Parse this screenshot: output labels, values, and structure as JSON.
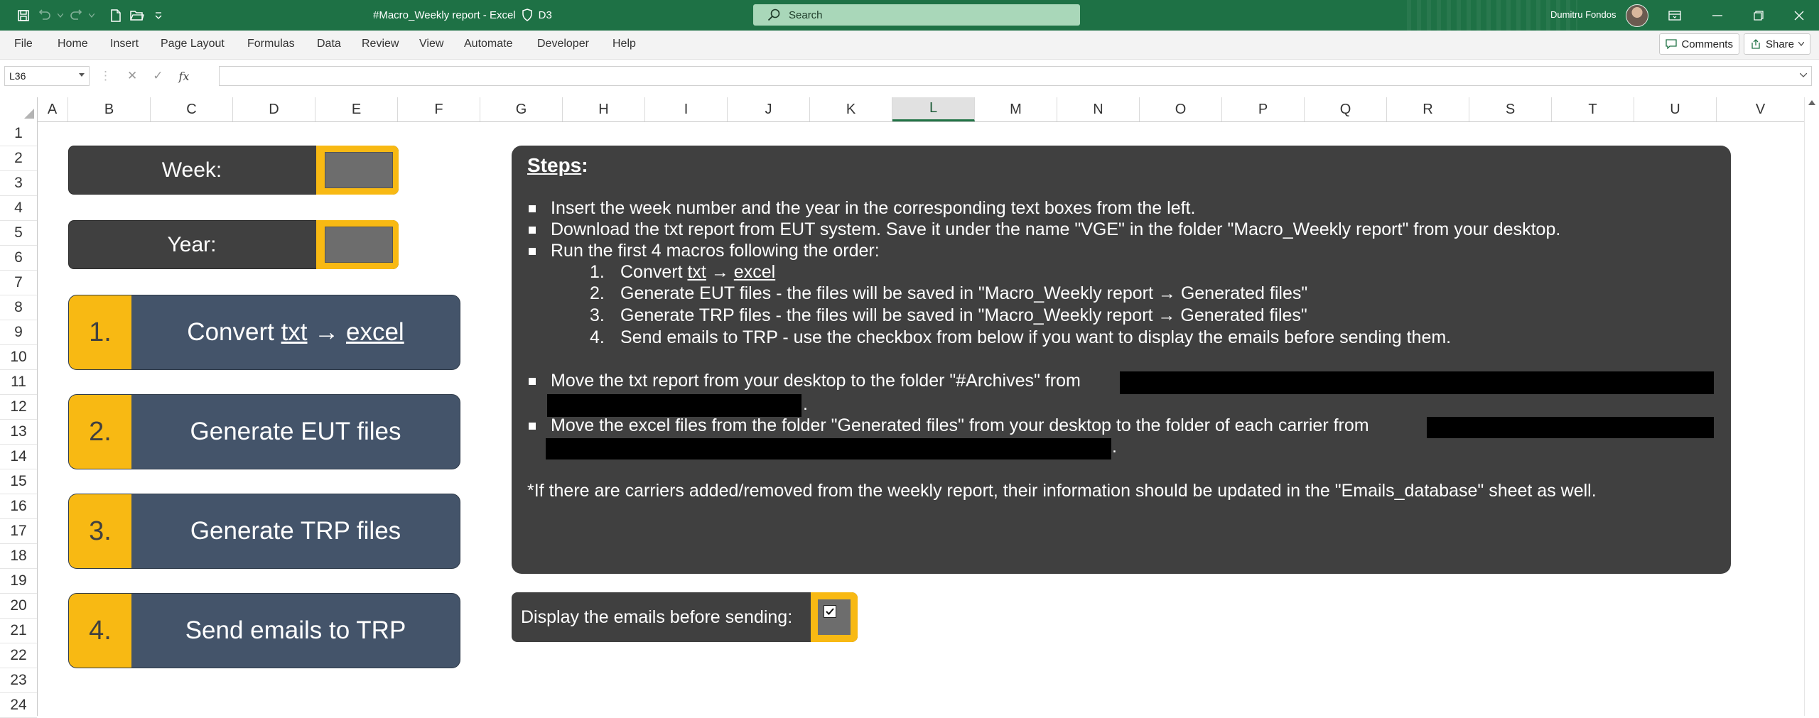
{
  "titlebar": {
    "doc_title": "#Macro_Weekly report  -  Excel",
    "sensitivity_label": "D3",
    "search_placeholder": "Search",
    "user_name": "Dumitru Fondos"
  },
  "menu": {
    "items": [
      "File",
      "Home",
      "Insert",
      "Page Layout",
      "Formulas",
      "Data",
      "Review",
      "View",
      "Automate",
      "Developer",
      "Help"
    ],
    "comments_label": "Comments",
    "share_label": "Share"
  },
  "formula_bar": {
    "name_box": "L36",
    "formula": ""
  },
  "grid": {
    "columns": [
      "A",
      "B",
      "C",
      "D",
      "E",
      "F",
      "G",
      "H",
      "I",
      "J",
      "K",
      "L",
      "M",
      "N",
      "O",
      "P",
      "Q",
      "R",
      "S",
      "T",
      "U",
      "V"
    ],
    "selected_column": "L",
    "rows": [
      "1",
      "2",
      "3",
      "4",
      "5",
      "6",
      "7",
      "8",
      "9",
      "10",
      "11",
      "12",
      "13",
      "14",
      "15",
      "16",
      "17",
      "18",
      "19",
      "20",
      "21",
      "22",
      "23",
      "24"
    ]
  },
  "inputs": {
    "week_label": "Week:",
    "year_label": "Year:",
    "week_value": "",
    "year_value": ""
  },
  "macros": [
    {
      "num": "1.",
      "pre": "Convert ",
      "txt": "txt",
      "arrow": " → ",
      "excel": "excel"
    },
    {
      "num": "2.",
      "label": "Generate EUT files"
    },
    {
      "num": "3.",
      "label": "Generate TRP files"
    },
    {
      "num": "4.",
      "label": "Send emails to TRP"
    }
  ],
  "steps": {
    "title": "Steps",
    "title_colon": ":",
    "b1": "Insert the week number and the year in the corresponding text boxes from the left.",
    "b2": "Download the txt report from EUT system. Save it under the name \"VGE\" in the folder \"Macro_Weekly report\" from your desktop.",
    "b3": "Run the first 4 macros following the order:",
    "sub": {
      "n1": "1.",
      "s1_pre": "Convert ",
      "s1_txt": "txt",
      "s1_arrow": " → ",
      "s1_excel": "excel",
      "n2": "2.",
      "s2": "Generate EUT files - the files will be saved in \"Macro_Weekly report → Generated files\"",
      "n3": "3.",
      "s3": "Generate TRP files - the files will be saved in \"Macro_Weekly report → Generated files\"",
      "n4": "4.",
      "s4": "Send emails to TRP - use the checkbox from below if you want to display the emails before sending them."
    },
    "b4": "Move the txt report from your desktop to the folder \"#Archives\" from",
    "b5": "Move the excel files from the folder \"Generated files\" from your desktop to the folder of each carrier from",
    "period": ".",
    "note": "*If there are carriers added/removed from the weekly report, their information should be updated in the \"Emails_database\" sheet as well."
  },
  "checkbox": {
    "label": "Display the emails before sending:",
    "checked": true
  },
  "colors": {
    "titlebar_green": "#1e7145",
    "panel_dark": "#404040",
    "button_slate": "#44546a",
    "accent_yellow": "#f8b913"
  }
}
